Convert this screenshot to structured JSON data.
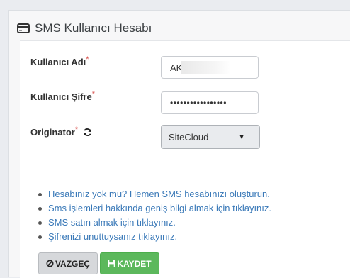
{
  "panel": {
    "title": "SMS Kullanıcı Hesabı",
    "icon": "credit-card-icon"
  },
  "form": {
    "username": {
      "label": "Kullanıcı Adı",
      "required_mark": "*",
      "value": "AK"
    },
    "password": {
      "label": "Kullanıcı Şifre",
      "required_mark": "*",
      "value": "•••••••••••••••••"
    },
    "originator": {
      "label": "Originator",
      "required_mark": "*",
      "refresh_icon": "refresh-icon",
      "selected": "SiteCloud"
    }
  },
  "links": [
    "Hesabınız yok mu? Hemen SMS hesabınızı oluşturun.",
    "Sms işlemleri hakkında geniş bilgi almak için tıklayınız.",
    "SMS satın almak için tıklayınız.",
    "Şifrenizi unuttuysanız tıklayınız."
  ],
  "buttons": {
    "cancel_label": "VAZGEÇ",
    "save_label": "KAYDET"
  },
  "colors": {
    "link": "#3a79b8",
    "required": "#d9534f",
    "save_button": "#5cb85c",
    "cancel_button": "#d6d8db"
  }
}
